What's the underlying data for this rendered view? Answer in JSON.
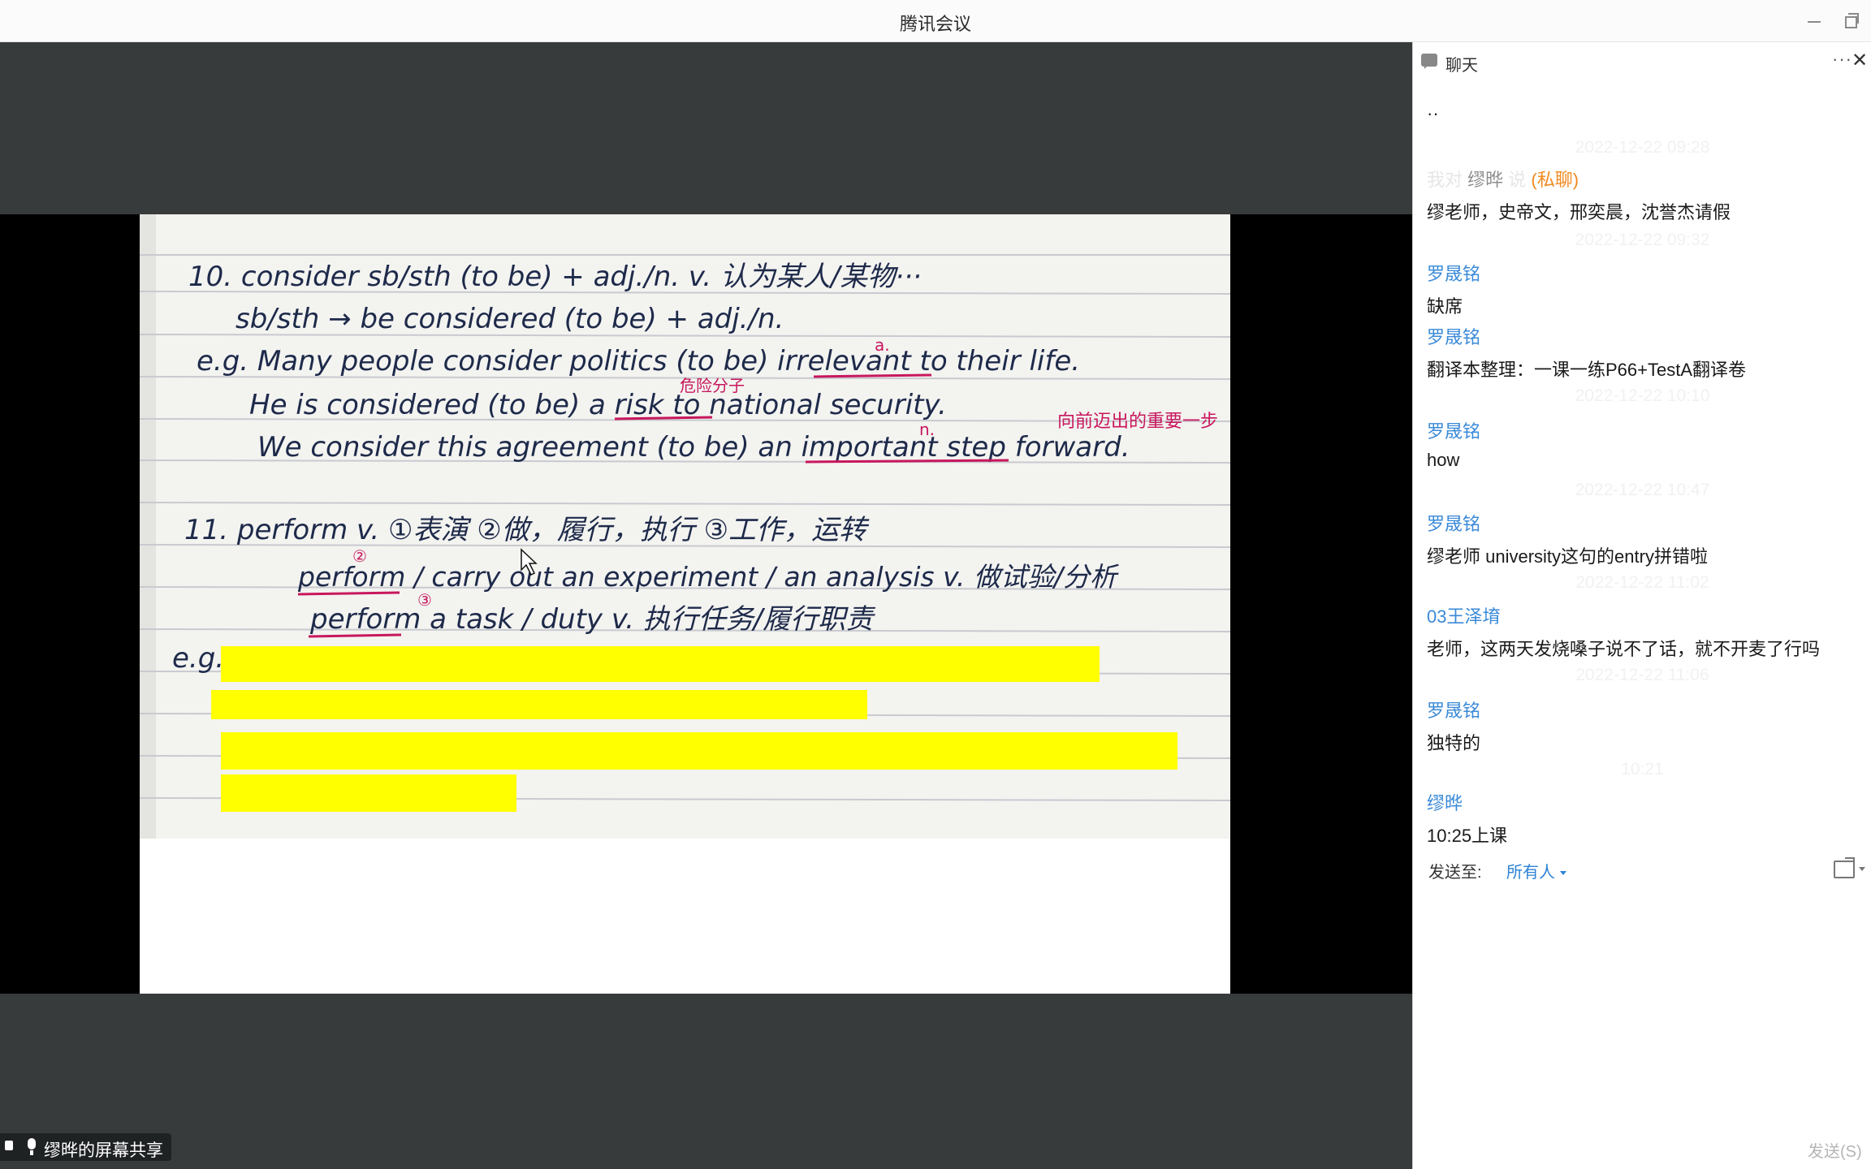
{
  "window": {
    "title": "腾讯会议"
  },
  "share": {
    "label": "缪晔的屏幕共享",
    "notes": [
      "10. consider sb/sth (to be) + adj./n.   v.  认为某人/某物···",
      "sb/sth → be considered (to be) + adj./n.",
      "e.g. Many people consider politics (to be) irrelevant to their life.",
      "He is considered (to be) a risk to national security.",
      "We consider this agreement (to be) an important step forward.",
      "11. perform   v.  ①表演  ②做，履行，执行  ③工作，运转",
      "perform / carry out an experiment / an analysis  v. 做试验/分析",
      "perform a task / duty   v.  执行任务/履行职责",
      "e.g."
    ],
    "annotations": [
      "a.",
      "危险分子",
      "n.",
      "向前迈出的重要一步",
      "②",
      "③"
    ]
  },
  "chat": {
    "title": "聊天",
    "partial_top": "··",
    "private": {
      "prefix": "我对",
      "name": "缪晔",
      "verb": "说",
      "tag": "(私聊)"
    },
    "messages": [
      {
        "time": "2022-12-22 09:28",
        "text": "缪老师，史帝文，邢奕晨，沈誉杰请假"
      },
      {
        "time": "2022-12-22 09:32",
        "sender": "罗晟铭",
        "text": "缺席"
      },
      {
        "sender": "罗晟铭",
        "text": "翻译本整理：一课一练P66+TestA翻译卷"
      },
      {
        "time": "2022-12-22 10:10",
        "sender": "罗晟铭",
        "text": "how"
      },
      {
        "time": "2022-12-22 10:47",
        "sender": "罗晟铭",
        "text": "缪老师 university这句的entry拼错啦"
      },
      {
        "time": "2022-12-22 11:02",
        "sender": "03王泽堉",
        "text": "老师，这两天发烧嗓子说不了话，就不开麦了行吗"
      },
      {
        "time": "2022-12-22 11:06",
        "sender": "罗晟铭",
        "text": "独特的"
      },
      {
        "time": "10:21",
        "sender": "缪晔",
        "text": "10:25上课"
      }
    ],
    "send_to_label": "发送至:",
    "send_to_value": "所有人",
    "send_label": "发送(S)",
    "input_value": ""
  },
  "colors": {
    "accent": "#3a8ad8",
    "private_tag": "#f08a20",
    "stage": "#373b3c",
    "highlight": "#ffff00",
    "ink": "#1e2a4a",
    "pen_red": "#c8175d"
  },
  "icons": [
    "chat-icon",
    "more-icon",
    "close-icon",
    "minimize-icon",
    "restore-icon",
    "file-icon",
    "screen-share-icon",
    "mic-icon",
    "cursor-icon"
  ]
}
